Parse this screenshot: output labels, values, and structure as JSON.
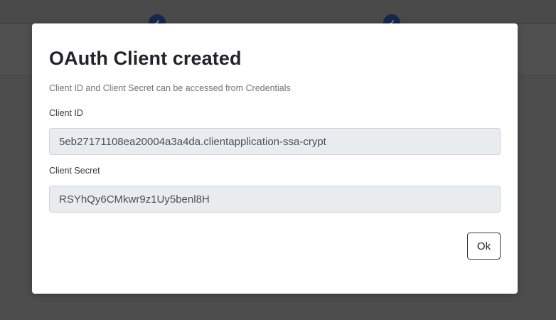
{
  "background": {
    "steps": [
      {
        "icon": "check-icon",
        "glyph": "✓"
      },
      {
        "icon": "check-icon",
        "glyph": "✓"
      }
    ]
  },
  "modal": {
    "title": "OAuth Client created",
    "subtitle": "Client ID and Client Secret can be accessed from Credentials",
    "client_id": {
      "label": "Client ID",
      "value": "5eb27171108ea20004a3a4da.clientapplication-ssa-crypt"
    },
    "client_secret": {
      "label": "Client Secret",
      "value": "RSYhQy6CMkwr9z1Uy5benl8H"
    },
    "ok_label": "Ok"
  },
  "colors": {
    "overlay": "#4d4d4d",
    "step_dot": "#15284a",
    "input_bg": "#e9ecef",
    "title_text": "#212529"
  }
}
